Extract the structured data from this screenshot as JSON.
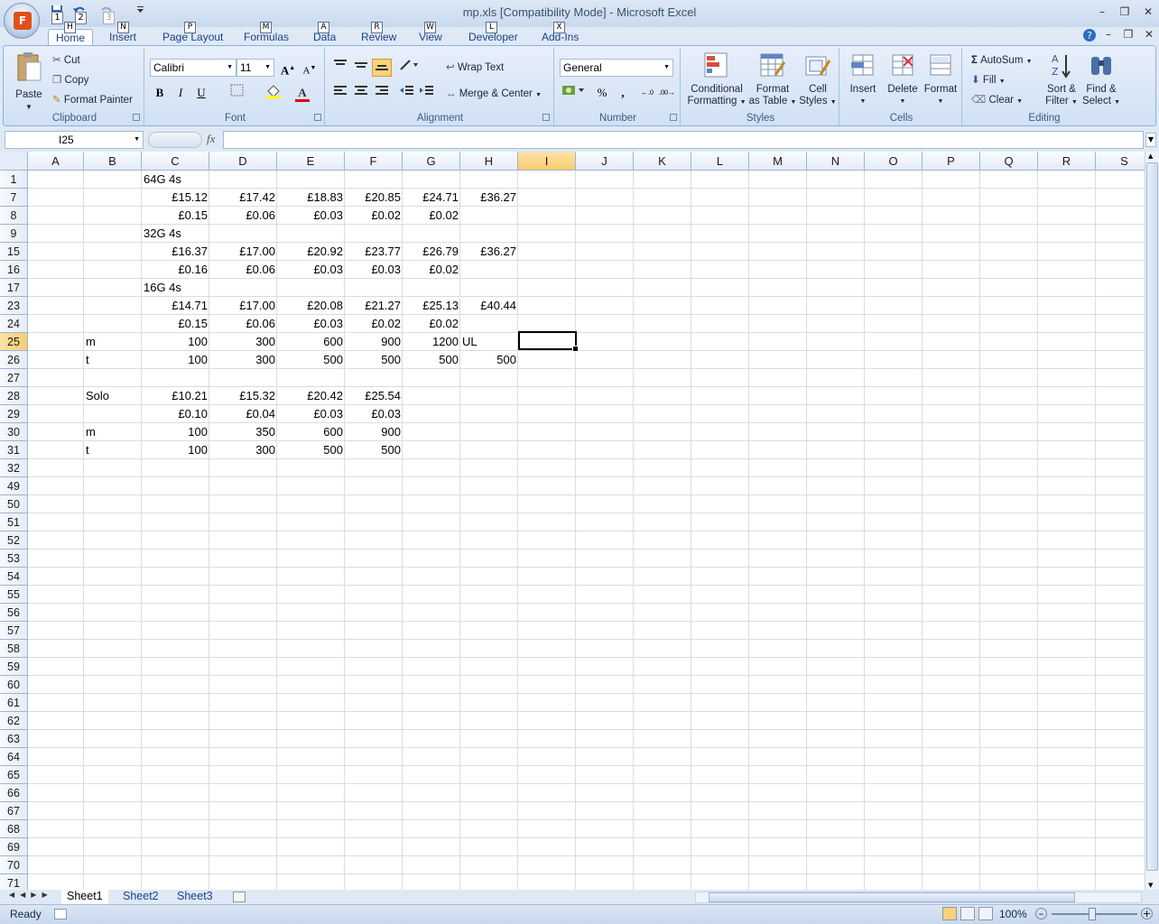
{
  "window": {
    "title": "mp.xls  [Compatibility Mode] - Microsoft Excel",
    "office_button_letter": "F",
    "qat_keytips": [
      "1",
      "2",
      "3"
    ]
  },
  "tabs": [
    {
      "label": "Home",
      "key": "H",
      "active": true
    },
    {
      "label": "Insert",
      "key": "N"
    },
    {
      "label": "Page Layout",
      "key": "P"
    },
    {
      "label": "Formulas",
      "key": "M"
    },
    {
      "label": "Data",
      "key": "A"
    },
    {
      "label": "Review",
      "key": "R"
    },
    {
      "label": "View",
      "key": "W"
    },
    {
      "label": "Developer",
      "key": "L"
    },
    {
      "label": "Add-Ins",
      "key": "X"
    }
  ],
  "ribbon": {
    "clipboard": {
      "label": "Clipboard",
      "paste": "Paste",
      "cut": "Cut",
      "copy": "Copy",
      "format_painter": "Format Painter"
    },
    "font": {
      "label": "Font",
      "family": "Calibri",
      "size": "11",
      "bold": "B",
      "italic": "I",
      "underline": "U",
      "font_color_letter": "A"
    },
    "alignment": {
      "label": "Alignment",
      "wrap_text": "Wrap Text",
      "merge_center": "Merge & Center"
    },
    "number": {
      "label": "Number",
      "format": "General",
      "percent": "%",
      "comma": ","
    },
    "styles": {
      "label": "Styles",
      "conditional_1": "Conditional",
      "conditional_2": "Formatting",
      "format_table_1": "Format",
      "format_table_2": "as Table",
      "cell_styles_1": "Cell",
      "cell_styles_2": "Styles"
    },
    "cells": {
      "label": "Cells",
      "insert": "Insert",
      "delete": "Delete",
      "format": "Format"
    },
    "editing": {
      "label": "Editing",
      "autosum": "AutoSum",
      "fill": "Fill",
      "clear": "Clear",
      "sort_1": "Sort &",
      "sort_2": "Filter",
      "find_1": "Find &",
      "find_2": "Select"
    }
  },
  "formula_bar": {
    "name_box": "I25",
    "fx": "fx",
    "value": ""
  },
  "columns": [
    "A",
    "B",
    "C",
    "D",
    "E",
    "F",
    "G",
    "H",
    "I",
    "J",
    "K",
    "L",
    "M",
    "N",
    "O",
    "P",
    "Q",
    "R",
    "S"
  ],
  "selected_column": "I",
  "rows": [
    "1",
    "7",
    "8",
    "9",
    "15",
    "16",
    "17",
    "23",
    "24",
    "25",
    "26",
    "27",
    "28",
    "29",
    "30",
    "31",
    "32",
    "49",
    "50",
    "51",
    "52",
    "53",
    "54",
    "55",
    "56",
    "57",
    "58",
    "59",
    "60",
    "61",
    "62",
    "63",
    "64",
    "65",
    "66",
    "67",
    "68",
    "69",
    "70",
    "71"
  ],
  "selected_row": "25",
  "cells": [
    {
      "row": 0,
      "col": "C",
      "text": "64G 4s",
      "align": "l"
    },
    {
      "row": 1,
      "col": "C",
      "text": "£15.12",
      "align": "r"
    },
    {
      "row": 1,
      "col": "D",
      "text": "£17.42",
      "align": "r"
    },
    {
      "row": 1,
      "col": "E",
      "text": "£18.83",
      "align": "r"
    },
    {
      "row": 1,
      "col": "F",
      "text": "£20.85",
      "align": "r"
    },
    {
      "row": 1,
      "col": "G",
      "text": "£24.71",
      "align": "r"
    },
    {
      "row": 1,
      "col": "H",
      "text": "£36.27",
      "align": "r"
    },
    {
      "row": 2,
      "col": "C",
      "text": "£0.15",
      "align": "r"
    },
    {
      "row": 2,
      "col": "D",
      "text": "£0.06",
      "align": "r"
    },
    {
      "row": 2,
      "col": "E",
      "text": "£0.03",
      "align": "r"
    },
    {
      "row": 2,
      "col": "F",
      "text": "£0.02",
      "align": "r"
    },
    {
      "row": 2,
      "col": "G",
      "text": "£0.02",
      "align": "r"
    },
    {
      "row": 3,
      "col": "C",
      "text": "32G 4s",
      "align": "l"
    },
    {
      "row": 4,
      "col": "C",
      "text": "£16.37",
      "align": "r"
    },
    {
      "row": 4,
      "col": "D",
      "text": "£17.00",
      "align": "r"
    },
    {
      "row": 4,
      "col": "E",
      "text": "£20.92",
      "align": "r"
    },
    {
      "row": 4,
      "col": "F",
      "text": "£23.77",
      "align": "r"
    },
    {
      "row": 4,
      "col": "G",
      "text": "£26.79",
      "align": "r"
    },
    {
      "row": 4,
      "col": "H",
      "text": "£36.27",
      "align": "r"
    },
    {
      "row": 5,
      "col": "C",
      "text": "£0.16",
      "align": "r"
    },
    {
      "row": 5,
      "col": "D",
      "text": "£0.06",
      "align": "r"
    },
    {
      "row": 5,
      "col": "E",
      "text": "£0.03",
      "align": "r"
    },
    {
      "row": 5,
      "col": "F",
      "text": "£0.03",
      "align": "r"
    },
    {
      "row": 5,
      "col": "G",
      "text": "£0.02",
      "align": "r"
    },
    {
      "row": 6,
      "col": "C",
      "text": "16G 4s",
      "align": "l"
    },
    {
      "row": 7,
      "col": "C",
      "text": "£14.71",
      "align": "r"
    },
    {
      "row": 7,
      "col": "D",
      "text": "£17.00",
      "align": "r"
    },
    {
      "row": 7,
      "col": "E",
      "text": "£20.08",
      "align": "r"
    },
    {
      "row": 7,
      "col": "F",
      "text": "£21.27",
      "align": "r"
    },
    {
      "row": 7,
      "col": "G",
      "text": "£25.13",
      "align": "r"
    },
    {
      "row": 7,
      "col": "H",
      "text": "£40.44",
      "align": "r"
    },
    {
      "row": 8,
      "col": "C",
      "text": "£0.15",
      "align": "r"
    },
    {
      "row": 8,
      "col": "D",
      "text": "£0.06",
      "align": "r"
    },
    {
      "row": 8,
      "col": "E",
      "text": "£0.03",
      "align": "r"
    },
    {
      "row": 8,
      "col": "F",
      "text": "£0.02",
      "align": "r"
    },
    {
      "row": 8,
      "col": "G",
      "text": "£0.02",
      "align": "r"
    },
    {
      "row": 9,
      "col": "B",
      "text": "m",
      "align": "l"
    },
    {
      "row": 9,
      "col": "C",
      "text": "100",
      "align": "r"
    },
    {
      "row": 9,
      "col": "D",
      "text": "300",
      "align": "r"
    },
    {
      "row": 9,
      "col": "E",
      "text": "600",
      "align": "r"
    },
    {
      "row": 9,
      "col": "F",
      "text": "900",
      "align": "r"
    },
    {
      "row": 9,
      "col": "G",
      "text": "1200",
      "align": "r"
    },
    {
      "row": 9,
      "col": "H",
      "text": "UL",
      "align": "l"
    },
    {
      "row": 10,
      "col": "B",
      "text": "t",
      "align": "l"
    },
    {
      "row": 10,
      "col": "C",
      "text": "100",
      "align": "r"
    },
    {
      "row": 10,
      "col": "D",
      "text": "300",
      "align": "r"
    },
    {
      "row": 10,
      "col": "E",
      "text": "500",
      "align": "r"
    },
    {
      "row": 10,
      "col": "F",
      "text": "500",
      "align": "r"
    },
    {
      "row": 10,
      "col": "G",
      "text": "500",
      "align": "r"
    },
    {
      "row": 10,
      "col": "H",
      "text": "500",
      "align": "r"
    },
    {
      "row": 12,
      "col": "B",
      "text": "Solo",
      "align": "l"
    },
    {
      "row": 12,
      "col": "C",
      "text": "£10.21",
      "align": "r"
    },
    {
      "row": 12,
      "col": "D",
      "text": "£15.32",
      "align": "r"
    },
    {
      "row": 12,
      "col": "E",
      "text": "£20.42",
      "align": "r"
    },
    {
      "row": 12,
      "col": "F",
      "text": "£25.54",
      "align": "r"
    },
    {
      "row": 13,
      "col": "C",
      "text": "£0.10",
      "align": "r"
    },
    {
      "row": 13,
      "col": "D",
      "text": "£0.04",
      "align": "r"
    },
    {
      "row": 13,
      "col": "E",
      "text": "£0.03",
      "align": "r"
    },
    {
      "row": 13,
      "col": "F",
      "text": "£0.03",
      "align": "r"
    },
    {
      "row": 14,
      "col": "B",
      "text": "m",
      "align": "l"
    },
    {
      "row": 14,
      "col": "C",
      "text": "100",
      "align": "r"
    },
    {
      "row": 14,
      "col": "D",
      "text": "350",
      "align": "r"
    },
    {
      "row": 14,
      "col": "E",
      "text": "600",
      "align": "r"
    },
    {
      "row": 14,
      "col": "F",
      "text": "900",
      "align": "r"
    },
    {
      "row": 15,
      "col": "B",
      "text": "t",
      "align": "l"
    },
    {
      "row": 15,
      "col": "C",
      "text": "100",
      "align": "r"
    },
    {
      "row": 15,
      "col": "D",
      "text": "300",
      "align": "r"
    },
    {
      "row": 15,
      "col": "E",
      "text": "500",
      "align": "r"
    },
    {
      "row": 15,
      "col": "F",
      "text": "500",
      "align": "r"
    }
  ],
  "sheets": [
    {
      "label": "Sheet1",
      "active": true
    },
    {
      "label": "Sheet2"
    },
    {
      "label": "Sheet3"
    }
  ],
  "status": {
    "ready": "Ready",
    "zoom": "100%"
  }
}
